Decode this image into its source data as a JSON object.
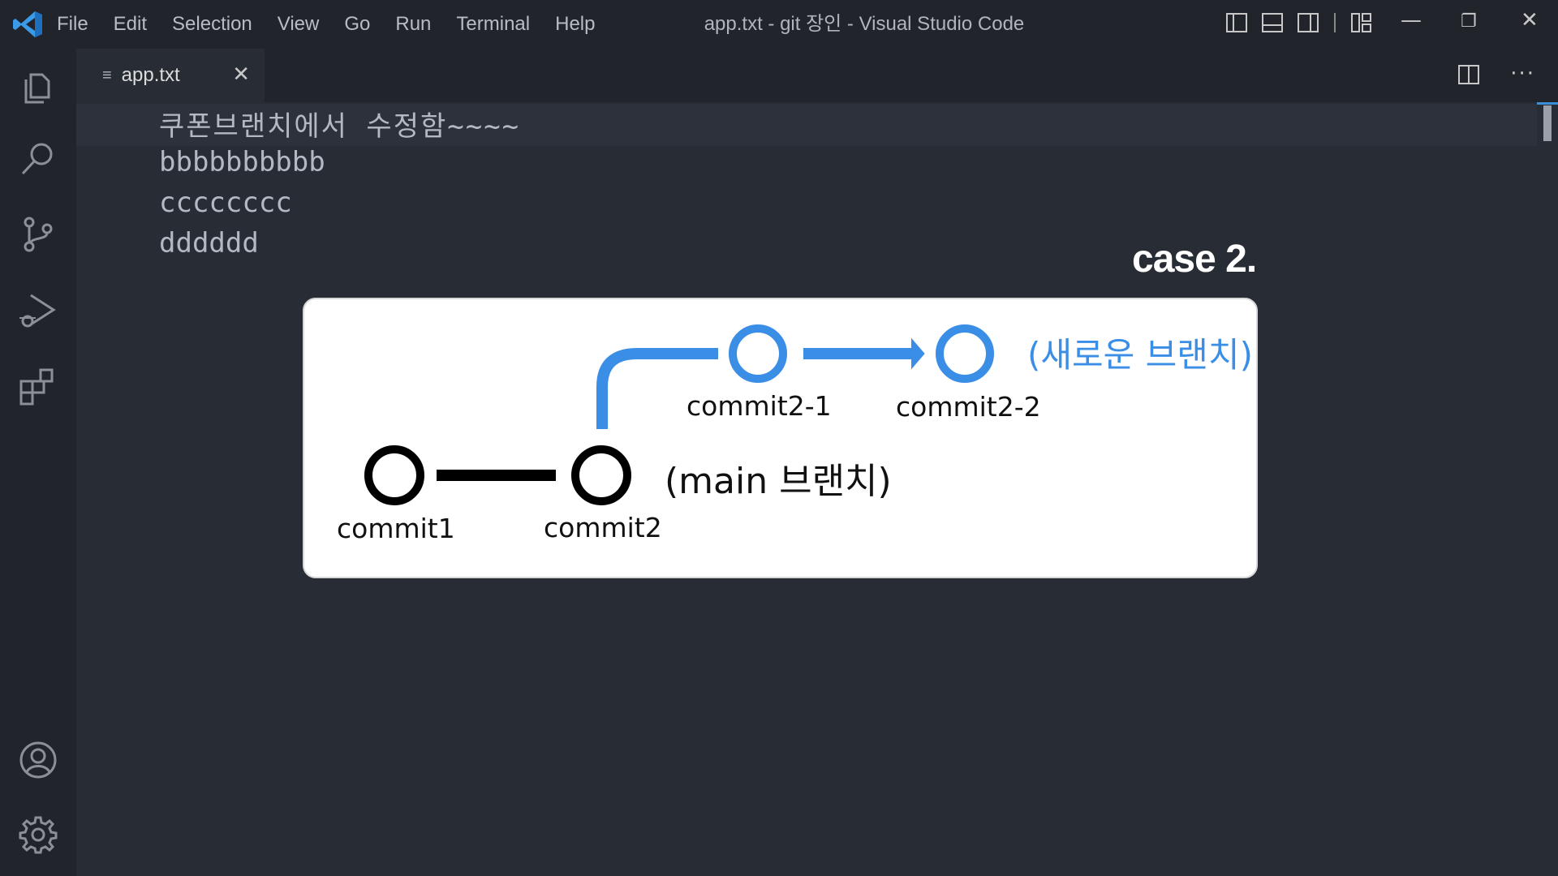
{
  "app": {
    "window_title": "app.txt - git 장인 - Visual Studio Code",
    "menu": [
      "File",
      "Edit",
      "Selection",
      "View",
      "Go",
      "Run",
      "Terminal",
      "Help"
    ],
    "window_controls": {
      "minimize": "—",
      "restore": "❐",
      "close": "✕"
    }
  },
  "activity_bar": {
    "items": [
      "files-icon",
      "search-icon",
      "source-control-icon",
      "run-debug-icon",
      "extensions-icon"
    ],
    "bottom": [
      "account-icon",
      "settings-gear-icon"
    ]
  },
  "tabs": [
    {
      "label": "app.txt",
      "active": true,
      "close": "✕"
    }
  ],
  "editor": {
    "lines": [
      "쿠폰브랜치에서 수정함~~~~",
      "bbbbbbbbbb",
      "cccccccc",
      "dddddd"
    ],
    "more_actions": "···"
  },
  "overlay": {
    "case_label": "case 2.",
    "commits": {
      "c1": "commit1",
      "c2": "commit2",
      "c21": "commit2-1",
      "c22": "commit2-2"
    },
    "main_branch": "(main 브랜치)",
    "new_branch": "(새로운 브랜치)",
    "colors": {
      "new_branch": "#3a8ee6",
      "main_branch": "#111111"
    }
  }
}
